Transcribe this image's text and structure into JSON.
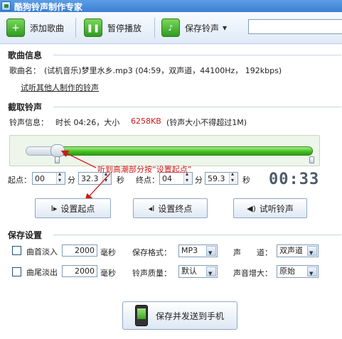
{
  "window": {
    "title": "酷狗铃声制作专家"
  },
  "toolbar": {
    "add_song": "添加歌曲",
    "pause_play": "暂停播放",
    "save_ringtone": "保存铃声"
  },
  "song_info": {
    "section_title": "歌曲信息",
    "song_name_label": "歌曲名：",
    "song_name_value": "(试机音乐)梦里水乡.mp3  (04:59，双声道，44100Hz，  192kbps)",
    "try_link": "试听其他人制作的铃声"
  },
  "cut": {
    "section_title": "截取铃声",
    "info_label": "铃声信息：",
    "info_value": "时长 04:26，大小",
    "size_value": "6258KB",
    "limit_note": "(铃声大小不得超过1M)",
    "start_label": "起点：",
    "start_min": "00",
    "min_unit": "分",
    "start_sec": "32.3",
    "sec_unit": "秒",
    "end_label": "终点：",
    "end_min": "04",
    "end_sec": "59.3",
    "timer": "00:33",
    "annotation": "听到高潮部分按“设置起点”",
    "set_start": "设置起点",
    "set_end": "设置终点",
    "preview": "试听铃声"
  },
  "save_settings": {
    "section_title": "保存设置",
    "fade_in_label": "曲首淡入",
    "fade_in_value": "2000",
    "fade_out_label": "曲尾淡出",
    "fade_out_value": "2000",
    "ms_unit": "毫秒",
    "format_label": "保存格式：",
    "format_value": "MP3",
    "quality_label": "铃声质量：",
    "quality_value": "默认",
    "channel_label": "声　　道：",
    "channel_value": "双声道",
    "boost_label": "声音增大：",
    "boost_value": "原始",
    "save_send_button": "保存并发送到手机"
  },
  "colors": {
    "accent_green": "#3fbd1e",
    "size_red": "#d01818",
    "title_blue": "#3d7fd2"
  }
}
